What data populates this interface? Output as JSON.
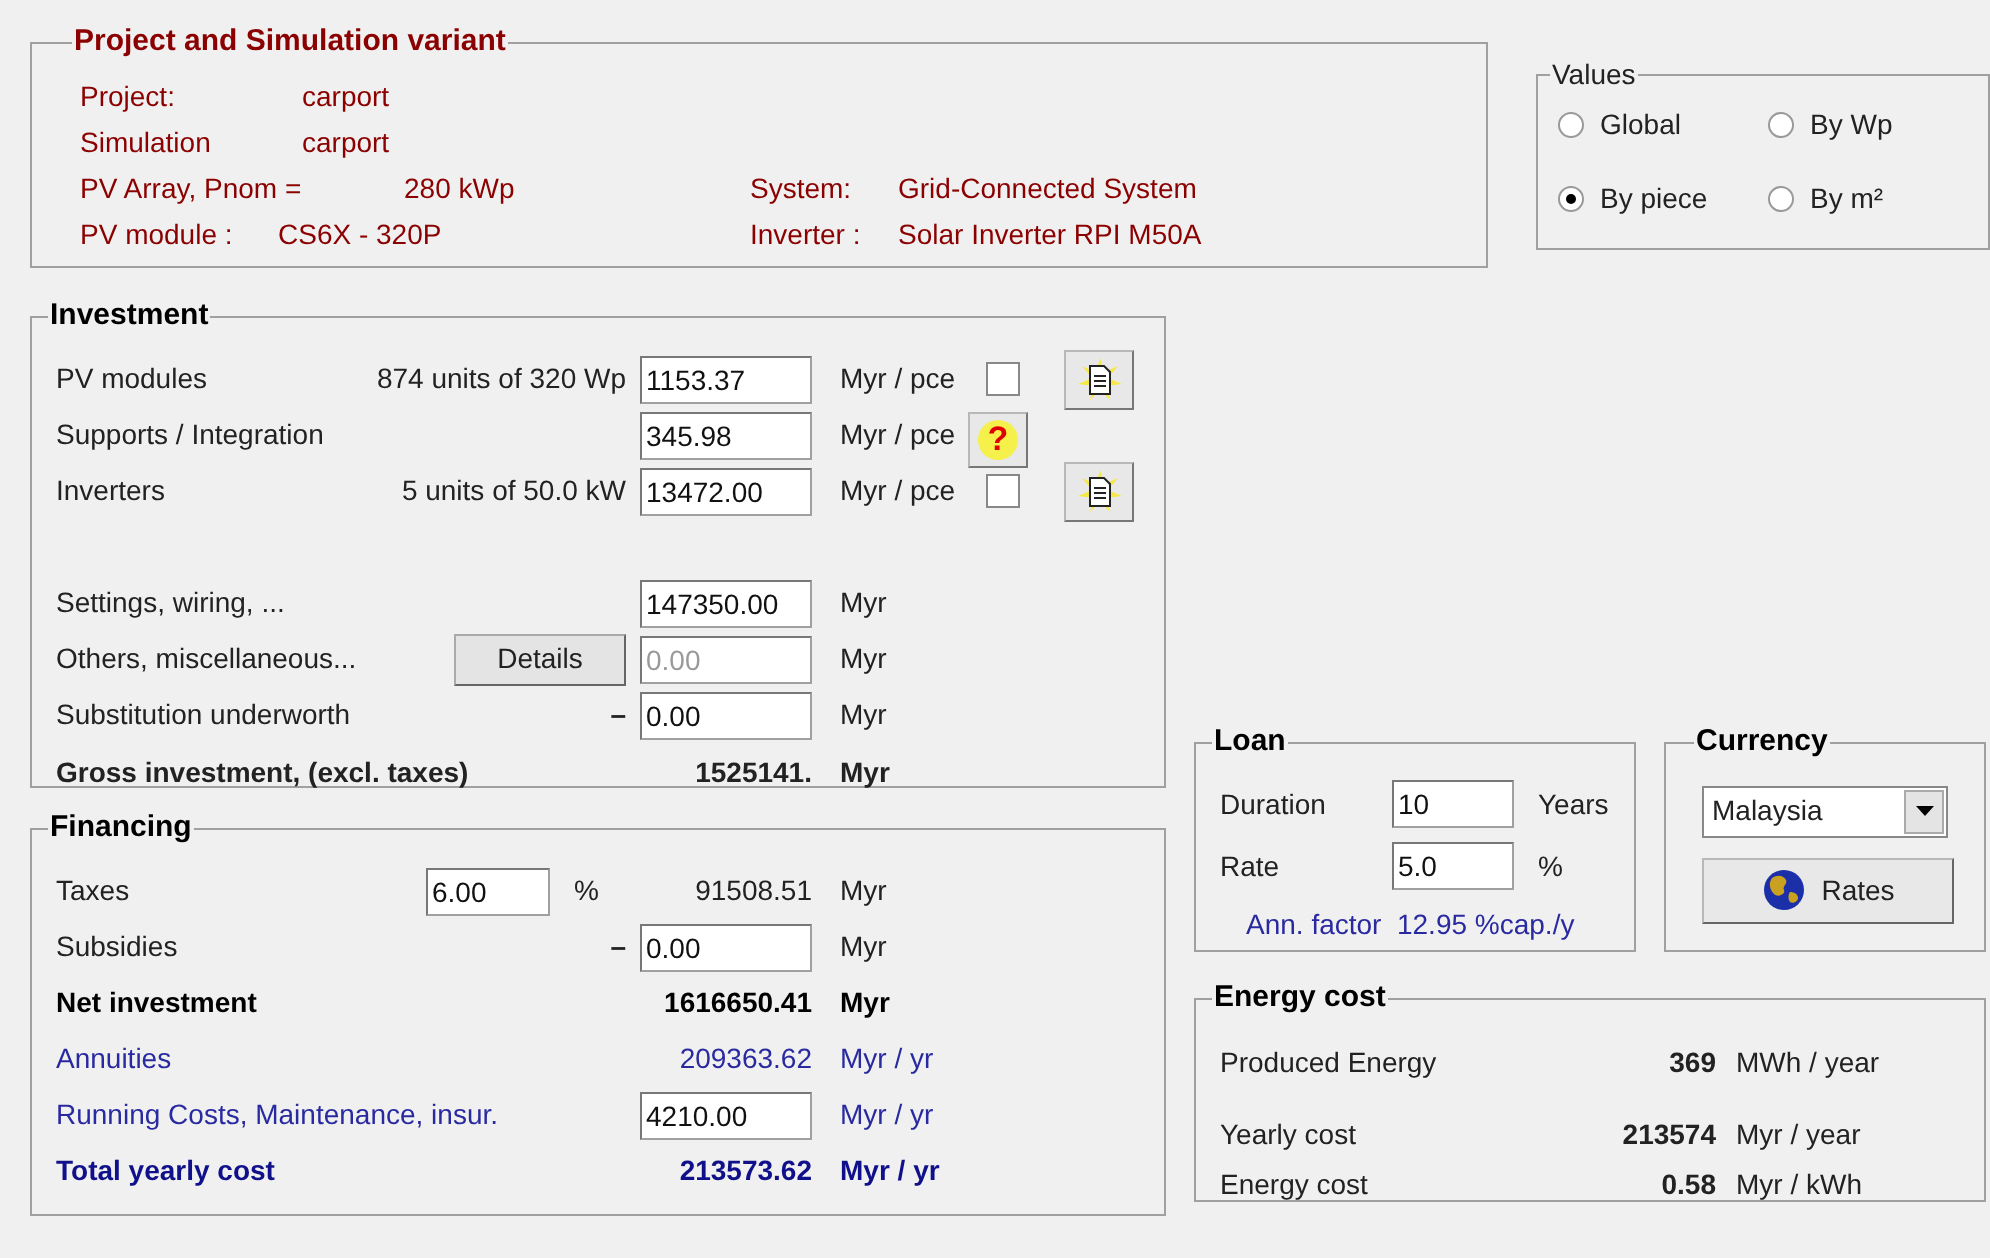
{
  "project": {
    "title": "Project and Simulation variant",
    "items": [
      {
        "label": "Project:",
        "value": "carport"
      },
      {
        "label": "Simulation",
        "value": "carport"
      },
      {
        "label": "PV Array, Pnom =",
        "value": "280 kWp"
      },
      {
        "label": "PV module :",
        "value": "CS6X - 320P"
      }
    ],
    "system": [
      {
        "label": "System:",
        "value": "Grid-Connected System"
      },
      {
        "label": "Inverter :",
        "value": "Solar Inverter RPI M50A"
      }
    ]
  },
  "values": {
    "title": "Values",
    "options": [
      {
        "label": "Global",
        "selected": false
      },
      {
        "label": "By Wp",
        "selected": false
      },
      {
        "label": "By piece",
        "selected": true
      },
      {
        "label": "By m²",
        "selected": false
      }
    ]
  },
  "investment": {
    "title": "Investment",
    "unit_costs": [
      {
        "label": "PV modules",
        "detail": "874 units of 320 Wp",
        "value": "1153.37",
        "unit": "Myr / pce",
        "checked": false,
        "kind": "doc"
      },
      {
        "label": "Supports / Integration",
        "value": "345.98",
        "unit": "Myr / pce",
        "kind": "help",
        "glyph": "?"
      },
      {
        "label": "Inverters",
        "detail": "5 units of 50.0 kW",
        "value": "13472.00",
        "unit": "Myr / pce",
        "checked": false,
        "kind": "doc"
      }
    ],
    "other_costs": [
      {
        "label": "Settings, wiring, ...",
        "value": "147350.00",
        "unit": "Myr",
        "disabled": false
      },
      {
        "label": "Others, miscellaneous...",
        "button": "Details",
        "value": "0.00",
        "unit": "Myr",
        "disabled": true
      },
      {
        "label": "Substitution underworth",
        "sign": "–",
        "value": "0.00",
        "unit": "Myr",
        "disabled": false
      }
    ],
    "gross": {
      "label": "Gross investment, (excl. taxes)",
      "value": "1525141.",
      "unit": "Myr"
    }
  },
  "financing": {
    "title": "Financing",
    "rows": [
      {
        "kind": "rate",
        "bold": false,
        "blue": false,
        "label": "Taxes",
        "rate": "6.00",
        "rate_unit": "%",
        "value": "91508.51",
        "unit": "Myr"
      },
      {
        "kind": "input",
        "bold": false,
        "blue": false,
        "label": "Subsidies",
        "sign": "–",
        "value": "0.00",
        "unit": "Myr"
      },
      {
        "kind": "value",
        "bold": true,
        "blue": false,
        "label": "Net investment",
        "value": "1616650.41",
        "unit": "Myr"
      },
      {
        "kind": "value",
        "bold": false,
        "blue": true,
        "label": "Annuities",
        "value": "209363.62",
        "unit": "Myr / yr"
      },
      {
        "kind": "input",
        "bold": false,
        "blue": true,
        "label": "Running Costs, Maintenance, insur.",
        "value": "4210.00",
        "unit": "Myr / yr"
      },
      {
        "kind": "value",
        "bold": true,
        "blue": true,
        "label": "Total yearly cost",
        "value": "213573.62",
        "unit": "Myr / yr"
      }
    ]
  },
  "loan": {
    "title": "Loan",
    "rows": [
      {
        "label": "Duration",
        "value": "10",
        "unit": "Years"
      },
      {
        "label": "Rate",
        "value": "5.0",
        "unit": "%"
      }
    ],
    "factor": "Ann. factor  12.95 %cap./y"
  },
  "currency": {
    "title": "Currency",
    "selection": "Malaysia",
    "button": "Rates"
  },
  "energy_cost": {
    "title": "Energy cost",
    "rows": [
      {
        "label": "Produced Energy",
        "value": "369",
        "unit": "MWh / year"
      },
      {
        "label": "Yearly cost",
        "value": "213574",
        "unit": "Myr / year"
      },
      {
        "label": "Energy cost",
        "value": "0.58",
        "unit": "Myr / kWh"
      }
    ]
  }
}
